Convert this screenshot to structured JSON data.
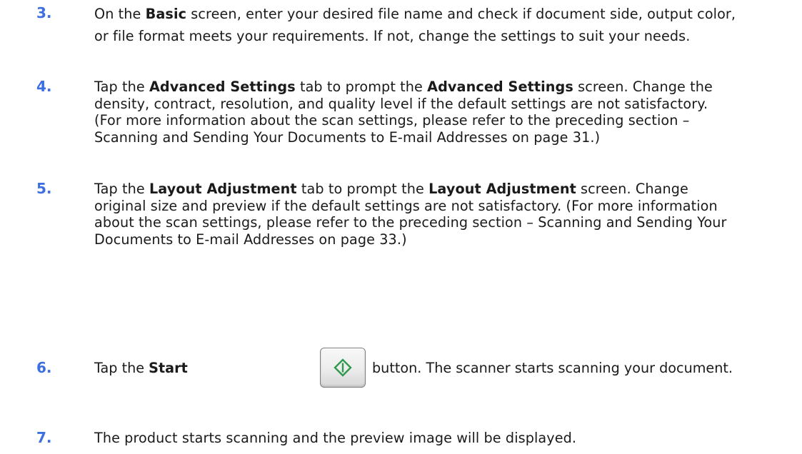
{
  "steps": [
    {
      "number": "3.",
      "pre1": "On the ",
      "bold1": "Basic",
      "post1": " screen, enter your desired file name and check if document side, output color, or file format meets your requirements.   If not, change the settings to suit your needs."
    },
    {
      "number": "4.",
      "pre1": "Tap the ",
      "bold1": "Advanced Settings",
      "mid1": " tab to prompt the ",
      "bold2": "Advanced Settings",
      "post1": " screen. Change the density, contract, resolution, and quality level if the default settings are not satisfactory. (For more information about the scan settings, please refer to the preceding section – Scanning and Sending Your Documents to E-mail Addresses on page 31.)"
    },
    {
      "number": "5.",
      "pre1": "Tap the ",
      "bold1": "Layout Adjustment",
      "mid1": " tab to prompt the ",
      "bold2": "Layout Adjustment",
      "post1": " screen. Change original size and preview if the default settings are not satisfactory. (For more information about the scan settings, please refer to the preceding section – Scanning and Sending Your Documents to E-mail Addresses on page 33.)"
    },
    {
      "number": "6.",
      "pre1": "Tap the ",
      "bold1": "Start",
      "button_icon": "start-diamond-icon",
      "post1": " button. The scanner starts scanning your document."
    },
    {
      "number": "7.",
      "pre1": "The product starts scanning and the preview image will be displayed."
    }
  ],
  "colors": {
    "step_number": "#3d6fe0",
    "start_icon": "#2f9a4f",
    "text": "#1a1a1a"
  }
}
